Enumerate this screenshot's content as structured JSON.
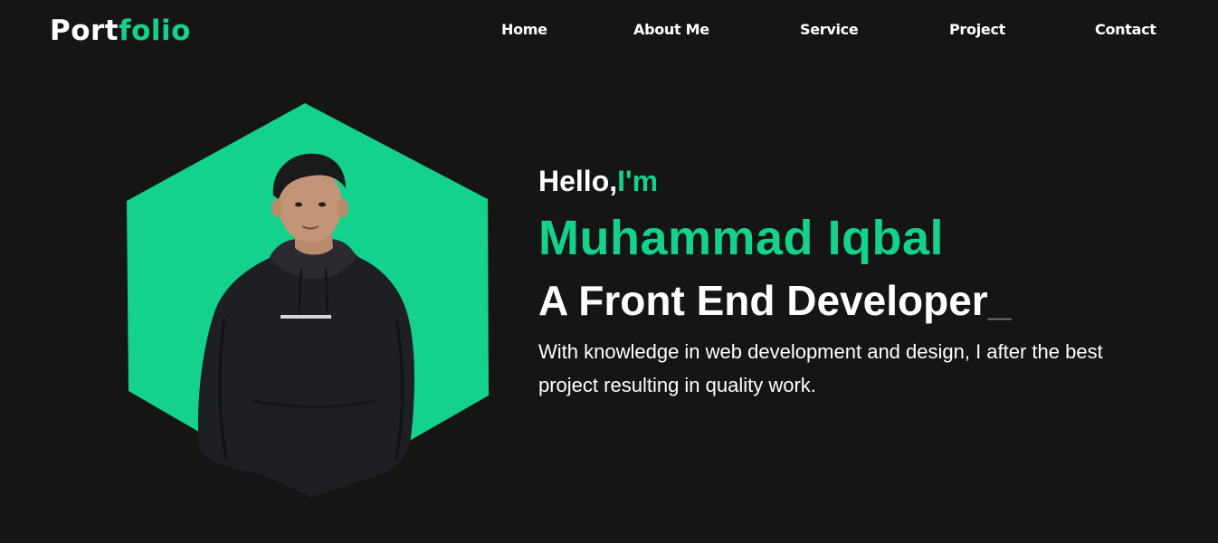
{
  "brand": {
    "logo_part1": "Port",
    "logo_part2": "folio"
  },
  "nav": {
    "items": [
      {
        "label": "Home"
      },
      {
        "label": "About Me"
      },
      {
        "label": "Service"
      },
      {
        "label": "Project"
      },
      {
        "label": "Contact"
      }
    ]
  },
  "hero": {
    "greeting_prefix": "Hello,",
    "greeting_accent": "I'm",
    "name": "Muhammad Iqbal",
    "role": "A Front End Developer",
    "cursor": "_",
    "description": "With knowledge in web development and design, I after the best project resulting in quality work."
  },
  "colors": {
    "background": "#151515",
    "accent": "#14d28b",
    "text": "#ffffff",
    "cursor": "#7a7a7a"
  }
}
